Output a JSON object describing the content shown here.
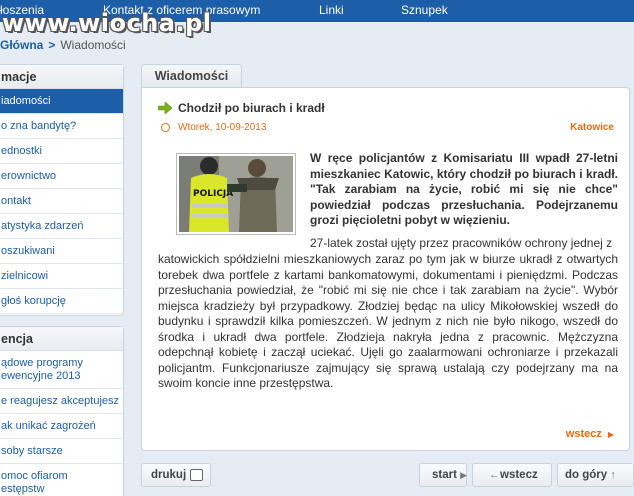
{
  "watermark": "www.wiocha.pl",
  "topnav": {
    "items": [
      "łoszenia",
      "Kontakt z oficerem prasowym",
      "Linki",
      "Sznupek"
    ]
  },
  "breadcrumb": {
    "home": "Główna",
    "separator": ">",
    "current": "Wiadomości"
  },
  "sidebar": {
    "box1": {
      "title": "macje",
      "items": [
        {
          "label": "iadomości",
          "active": true
        },
        {
          "label": "o zna bandytę?"
        },
        {
          "label": "ednostki"
        },
        {
          "label": "erownictwo"
        },
        {
          "label": "ontakt"
        },
        {
          "label": "atystyka zdarzeń"
        },
        {
          "label": "oszukiwani"
        },
        {
          "label": "zielnicowi"
        },
        {
          "label": "głoś korupcję"
        }
      ]
    },
    "box2": {
      "title": "encja",
      "items": [
        {
          "label": "ądowe programy\newencyjne 2013"
        },
        {
          "label": "e reagujesz akceptujesz"
        },
        {
          "label": "ak unikać zagrożeń"
        },
        {
          "label": "soby starsze"
        },
        {
          "label": "omoc ofiarom\nestępstw"
        }
      ]
    }
  },
  "main": {
    "tab_label": "Wiadomości",
    "article": {
      "title": "Chodził po biurach i kradł",
      "date": "Wtorek, 10-09-2013",
      "city": "Katowice",
      "photo_caption": "POLICJA",
      "lead": "W ręce policjantów  z Komisariatu III wpadł 27-letni mieszkaniec Katowic, który chodził po biurach i kradł. \"Tak zarabiam na życie, robić mi się nie chce\" powiedział podczas przesłuchania. Podejrzanemu grozi pięcioletni pobyt w więzieniu.",
      "lead_extra": "27-latek został ujęty przez pracowników ochrony jednej z",
      "body": "katowickich spółdzielni mieszkaniowych zaraz po tym jak w biurze ukradł z otwartych torebek dwa portfele z kartami bankomatowymi, dokumentami i pieniędzmi. Podczas przesłuchania powiedział, że \"robić mi się nie chce i tak zarabiam na życie\". Wybór miejsca kradzieży był przypadkowy. Złodziej będąc na ulicy Mikołowskiej wszedł do budynku i sprawdził kilka pomieszczeń. W jednym z nich nie było nikogo, wszedł do środka i ukradł dwa portfele. Złodzieja nakryła jedna z pracownic. Mężczyzna odepchnął kobietę i zaczął uciekać. Ujęli go zaalarmowani ochroniarze i przekazali policjantm. Funkcjonariusze zajmujący się sprawą ustalają czy podejrzany ma na swoim koncie inne przestępstwa.",
      "back_link": "wstecz"
    }
  },
  "bottom": {
    "print_label": "drukuj",
    "start_label": "start",
    "back_label": "wstecz",
    "top_label": "do góry"
  },
  "colors": {
    "brand_blue": "#1d5ea8",
    "accent_orange": "#e86a10",
    "arrow_green": "#7ab317"
  }
}
